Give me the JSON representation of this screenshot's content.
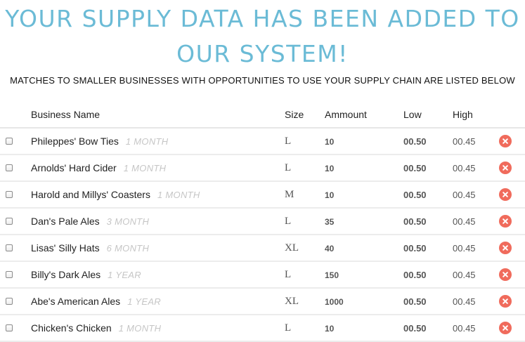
{
  "headline": {
    "line1": "YOUR SUPPLY DATA HAS BEEN ADDED TO",
    "line2": "OUR SYSTEM!",
    "color": "#6bbbd6"
  },
  "subheading": "MATCHES TO SMALLER BUSINESSES WITH OPPORTUNITIES TO USE YOUR SUPPLY CHAIN ARE LISTED BELOW",
  "table": {
    "headers": {
      "name": "Business Name",
      "size": "Size",
      "amount": "Ammount",
      "low": "Low",
      "high": "High"
    },
    "rows": [
      {
        "name": "Phileppes' Bow Ties",
        "term": "1 MONTH",
        "size": "L",
        "amount": "10",
        "low": "00.50",
        "high": "00.45",
        "checked": false
      },
      {
        "name": "Arnolds' Hard Cider",
        "term": "1 MONTH",
        "size": "L",
        "amount": "10",
        "low": "00.50",
        "high": "00.45",
        "checked": false
      },
      {
        "name": "Harold and Millys' Coasters",
        "term": "1 MONTH",
        "size": "M",
        "amount": "10",
        "low": "00.50",
        "high": "00.45",
        "checked": false
      },
      {
        "name": "Dan's Pale Ales",
        "term": "3 MONTH",
        "size": "L",
        "amount": "35",
        "low": "00.50",
        "high": "00.45",
        "checked": false
      },
      {
        "name": "Lisas' Silly Hats",
        "term": "6 MONTH",
        "size": "XL",
        "amount": "40",
        "low": "00.50",
        "high": "00.45",
        "checked": false
      },
      {
        "name": "Billy's Dark Ales",
        "term": "1 YEAR",
        "size": "L",
        "amount": "150",
        "low": "00.50",
        "high": "00.45",
        "checked": false
      },
      {
        "name": "Abe's American Ales",
        "term": "1 YEAR",
        "size": "XL",
        "amount": "1000",
        "low": "00.50",
        "high": "00.45",
        "checked": false
      },
      {
        "name": "Chicken's Chicken",
        "term": "1 MONTH",
        "size": "L",
        "amount": "10",
        "low": "00.50",
        "high": "00.45",
        "checked": false
      }
    ],
    "remove_icon": "close-circle-icon",
    "remove_color": "#f06b5c"
  }
}
